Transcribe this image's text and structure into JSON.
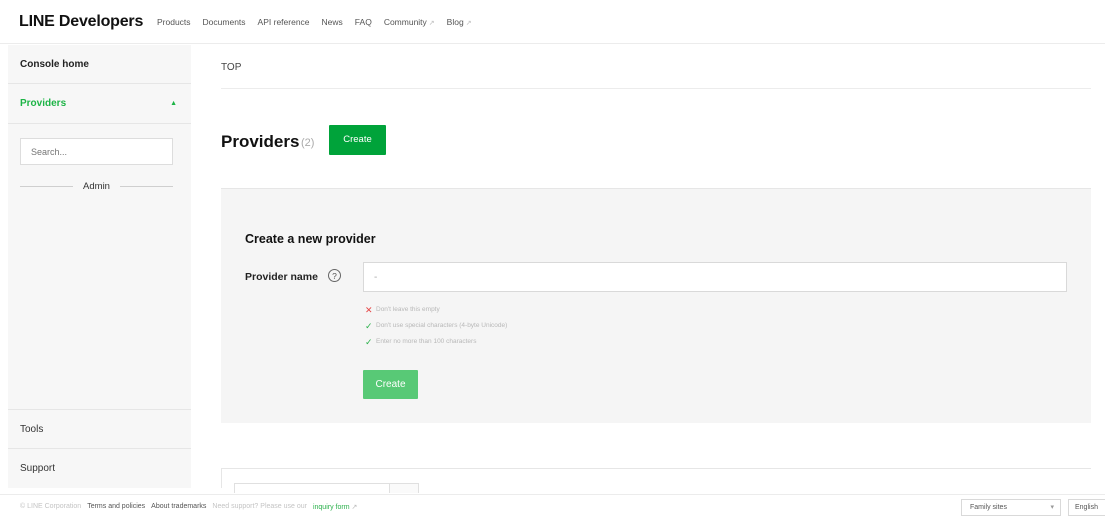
{
  "header": {
    "brand": "LINE Developers",
    "nav": [
      "Products",
      "Documents",
      "API reference",
      "News",
      "FAQ",
      "Community",
      "Blog"
    ]
  },
  "sidebar": {
    "console_home": "Console home",
    "providers": "Providers",
    "search_placeholder": "Search...",
    "admin_label": "Admin",
    "tools": "Tools",
    "support": "Support"
  },
  "main": {
    "breadcrumb": "TOP",
    "title": "Providers",
    "count": "(2)",
    "create_button": "Create",
    "form": {
      "title": "Create a new provider",
      "field_label": "Provider name",
      "input_value": "-",
      "rules": [
        {
          "text": "Don't leave this empty",
          "status": "error"
        },
        {
          "text": "Don't use special characters (4-byte Unicode)",
          "status": "ok"
        },
        {
          "text": "Enter no more than 100 characters",
          "status": "ok"
        }
      ],
      "submit_label": "Create"
    }
  },
  "footer": {
    "copyright": "© LINE Corporation",
    "terms": "Terms and policies",
    "trademarks": "About trademarks",
    "support_text": "Need support? Please use our",
    "inquiry_link": "inquiry form",
    "family_sites": "Family sites",
    "language": "English"
  },
  "colors": {
    "brand_green": "#00a33a",
    "sidebar_active": "#1db446",
    "disabled_green": "#58c976",
    "error_red": "#e54545"
  }
}
